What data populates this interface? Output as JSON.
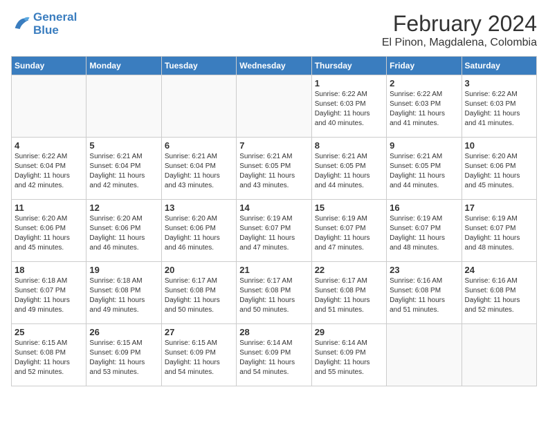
{
  "logo": {
    "line1": "General",
    "line2": "Blue"
  },
  "title": "February 2024",
  "subtitle": "El Pinon, Magdalena, Colombia",
  "days_of_week": [
    "Sunday",
    "Monday",
    "Tuesday",
    "Wednesday",
    "Thursday",
    "Friday",
    "Saturday"
  ],
  "weeks": [
    [
      {
        "day": "",
        "details": ""
      },
      {
        "day": "",
        "details": ""
      },
      {
        "day": "",
        "details": ""
      },
      {
        "day": "",
        "details": ""
      },
      {
        "day": "1",
        "details": "Sunrise: 6:22 AM\nSunset: 6:03 PM\nDaylight: 11 hours\nand 40 minutes."
      },
      {
        "day": "2",
        "details": "Sunrise: 6:22 AM\nSunset: 6:03 PM\nDaylight: 11 hours\nand 41 minutes."
      },
      {
        "day": "3",
        "details": "Sunrise: 6:22 AM\nSunset: 6:03 PM\nDaylight: 11 hours\nand 41 minutes."
      }
    ],
    [
      {
        "day": "4",
        "details": "Sunrise: 6:22 AM\nSunset: 6:04 PM\nDaylight: 11 hours\nand 42 minutes."
      },
      {
        "day": "5",
        "details": "Sunrise: 6:21 AM\nSunset: 6:04 PM\nDaylight: 11 hours\nand 42 minutes."
      },
      {
        "day": "6",
        "details": "Sunrise: 6:21 AM\nSunset: 6:04 PM\nDaylight: 11 hours\nand 43 minutes."
      },
      {
        "day": "7",
        "details": "Sunrise: 6:21 AM\nSunset: 6:05 PM\nDaylight: 11 hours\nand 43 minutes."
      },
      {
        "day": "8",
        "details": "Sunrise: 6:21 AM\nSunset: 6:05 PM\nDaylight: 11 hours\nand 44 minutes."
      },
      {
        "day": "9",
        "details": "Sunrise: 6:21 AM\nSunset: 6:05 PM\nDaylight: 11 hours\nand 44 minutes."
      },
      {
        "day": "10",
        "details": "Sunrise: 6:20 AM\nSunset: 6:06 PM\nDaylight: 11 hours\nand 45 minutes."
      }
    ],
    [
      {
        "day": "11",
        "details": "Sunrise: 6:20 AM\nSunset: 6:06 PM\nDaylight: 11 hours\nand 45 minutes."
      },
      {
        "day": "12",
        "details": "Sunrise: 6:20 AM\nSunset: 6:06 PM\nDaylight: 11 hours\nand 46 minutes."
      },
      {
        "day": "13",
        "details": "Sunrise: 6:20 AM\nSunset: 6:06 PM\nDaylight: 11 hours\nand 46 minutes."
      },
      {
        "day": "14",
        "details": "Sunrise: 6:19 AM\nSunset: 6:07 PM\nDaylight: 11 hours\nand 47 minutes."
      },
      {
        "day": "15",
        "details": "Sunrise: 6:19 AM\nSunset: 6:07 PM\nDaylight: 11 hours\nand 47 minutes."
      },
      {
        "day": "16",
        "details": "Sunrise: 6:19 AM\nSunset: 6:07 PM\nDaylight: 11 hours\nand 48 minutes."
      },
      {
        "day": "17",
        "details": "Sunrise: 6:19 AM\nSunset: 6:07 PM\nDaylight: 11 hours\nand 48 minutes."
      }
    ],
    [
      {
        "day": "18",
        "details": "Sunrise: 6:18 AM\nSunset: 6:07 PM\nDaylight: 11 hours\nand 49 minutes."
      },
      {
        "day": "19",
        "details": "Sunrise: 6:18 AM\nSunset: 6:08 PM\nDaylight: 11 hours\nand 49 minutes."
      },
      {
        "day": "20",
        "details": "Sunrise: 6:17 AM\nSunset: 6:08 PM\nDaylight: 11 hours\nand 50 minutes."
      },
      {
        "day": "21",
        "details": "Sunrise: 6:17 AM\nSunset: 6:08 PM\nDaylight: 11 hours\nand 50 minutes."
      },
      {
        "day": "22",
        "details": "Sunrise: 6:17 AM\nSunset: 6:08 PM\nDaylight: 11 hours\nand 51 minutes."
      },
      {
        "day": "23",
        "details": "Sunrise: 6:16 AM\nSunset: 6:08 PM\nDaylight: 11 hours\nand 51 minutes."
      },
      {
        "day": "24",
        "details": "Sunrise: 6:16 AM\nSunset: 6:08 PM\nDaylight: 11 hours\nand 52 minutes."
      }
    ],
    [
      {
        "day": "25",
        "details": "Sunrise: 6:15 AM\nSunset: 6:08 PM\nDaylight: 11 hours\nand 52 minutes."
      },
      {
        "day": "26",
        "details": "Sunrise: 6:15 AM\nSunset: 6:09 PM\nDaylight: 11 hours\nand 53 minutes."
      },
      {
        "day": "27",
        "details": "Sunrise: 6:15 AM\nSunset: 6:09 PM\nDaylight: 11 hours\nand 54 minutes."
      },
      {
        "day": "28",
        "details": "Sunrise: 6:14 AM\nSunset: 6:09 PM\nDaylight: 11 hours\nand 54 minutes."
      },
      {
        "day": "29",
        "details": "Sunrise: 6:14 AM\nSunset: 6:09 PM\nDaylight: 11 hours\nand 55 minutes."
      },
      {
        "day": "",
        "details": ""
      },
      {
        "day": "",
        "details": ""
      }
    ]
  ]
}
